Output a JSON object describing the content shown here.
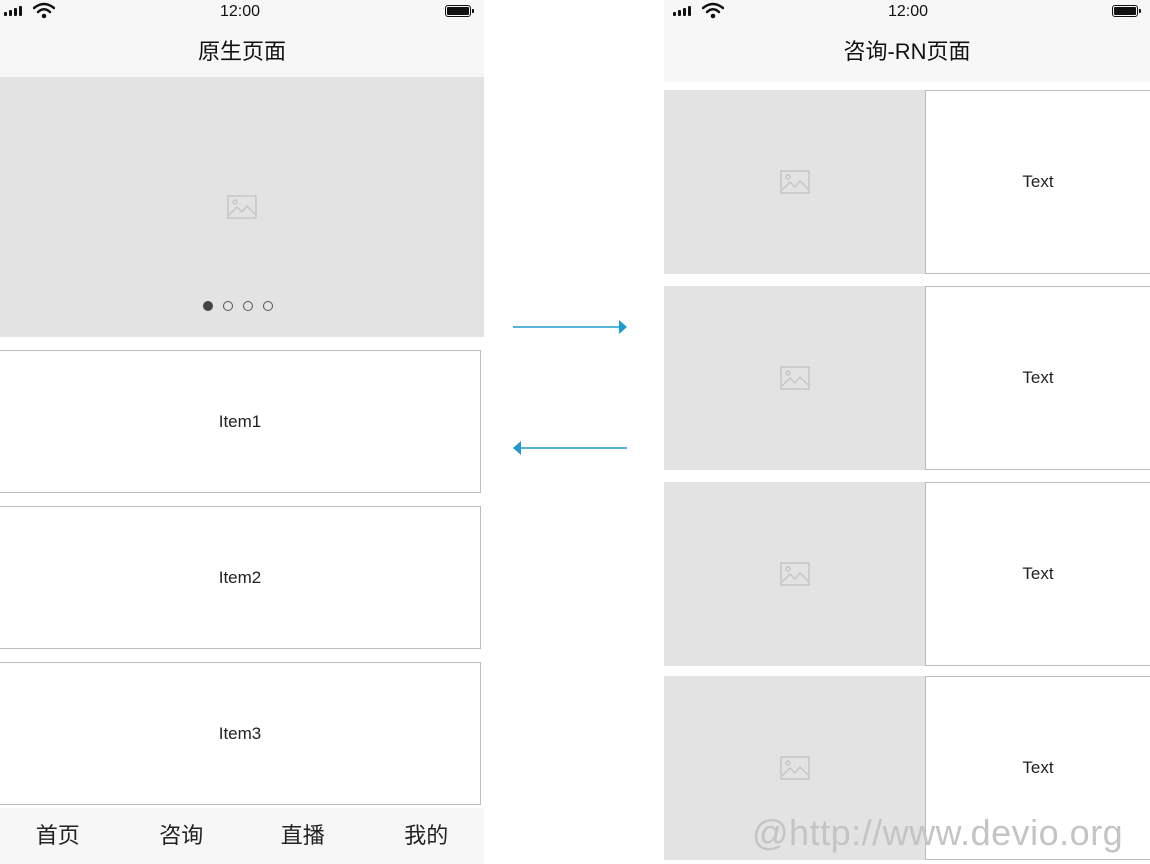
{
  "status_bar": {
    "time": "12:00"
  },
  "native_page": {
    "title": "原生页面",
    "carousel": {
      "dot_count": 4,
      "active_index": 0
    },
    "items": [
      "Item1",
      "Item2",
      "Item3"
    ],
    "tabs": [
      "首页",
      "咨询",
      "直播",
      "我的"
    ]
  },
  "rn_page": {
    "title": "咨询-RN页面",
    "rows": [
      "Text",
      "Text",
      "Text",
      "Text"
    ]
  },
  "arrows": {
    "color": "#1f9bcf"
  },
  "watermark": "@http://www.devio.org"
}
